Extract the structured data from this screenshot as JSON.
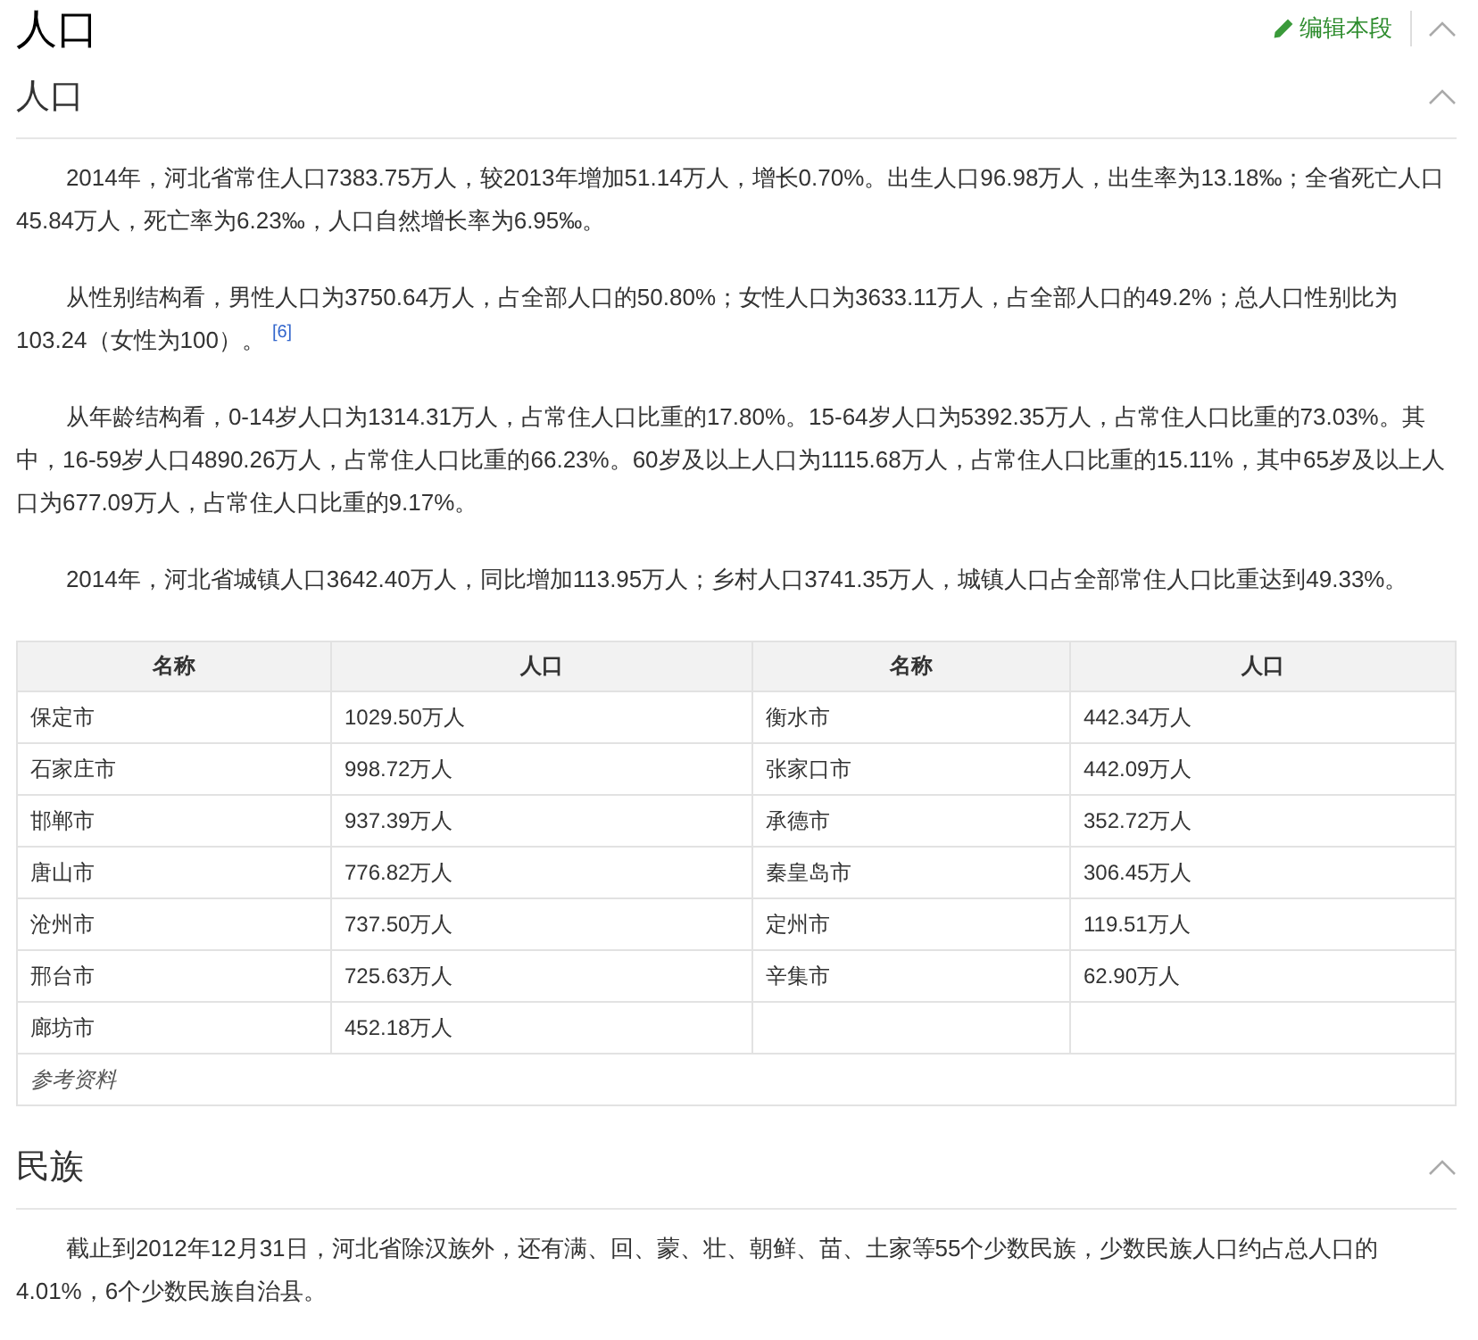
{
  "page_title": "人口",
  "edit_link": "编辑本段",
  "sections": [
    {
      "heading": "人口",
      "expanded": true,
      "blocks": [
        {
          "kind": "paragraph",
          "text": "2014年，河北省常住人口7383.75万人，较2013年增加51.14万人，增长0.70%。出生人口96.98万人，出生率为13.18‰；全省死亡人口45.84万人，死亡率为6.23‰，人口自然增长率为6.95‰。"
        },
        {
          "kind": "paragraph",
          "text": "从性别结构看，男性人口为3750.64万人，占全部人口的50.80%；女性人口为3633.11万人，占全部人口的49.2%；总人口性别比为103.24（女性为100）。",
          "ref": "[6]"
        },
        {
          "kind": "paragraph",
          "text": "从年龄结构看，0-14岁人口为1314.31万人，占常住人口比重的17.80%。15-64岁人口为5392.35万人，占常住人口比重的73.03%。其中，16-59岁人口4890.26万人，占常住人口比重的66.23%。60岁及以上人口为1115.68万人，占常住人口比重的15.11%，其中65岁及以上人口为677.09万人，占常住人口比重的9.17%。"
        },
        {
          "kind": "paragraph",
          "text": "2014年，河北省城镇人口3642.40万人，同比增加113.95万人；乡村人口3741.35万人，城镇人口占全部常住人口比重达到49.33%。"
        },
        {
          "kind": "table",
          "columns": [
            "名称",
            "人口",
            "名称",
            "人口"
          ],
          "rows": [
            [
              "保定市",
              "1029.50万人",
              "衡水市",
              "442.34万人"
            ],
            [
              "石家庄市",
              "998.72万人",
              "张家口市",
              "442.09万人"
            ],
            [
              "邯郸市",
              "937.39万人",
              "承德市",
              "352.72万人"
            ],
            [
              "唐山市",
              "776.82万人",
              "秦皇岛市",
              "306.45万人"
            ],
            [
              "沧州市",
              "737.50万人",
              "定州市",
              "119.51万人"
            ],
            [
              "邢台市",
              "725.63万人",
              "辛集市",
              "62.90万人"
            ],
            [
              "廊坊市",
              "452.18万人"
            ]
          ],
          "footer": "参考资料"
        }
      ]
    },
    {
      "heading": "民族",
      "expanded": true,
      "blocks": [
        {
          "kind": "paragraph",
          "text": "截止到2012年12月31日，河北省除汉族外，还有满、回、蒙、壮、朝鲜、苗、土家等55个少数民族，少数民族人口约占总人口的4.01%，6个少数民族自治县。"
        }
      ]
    }
  ]
}
